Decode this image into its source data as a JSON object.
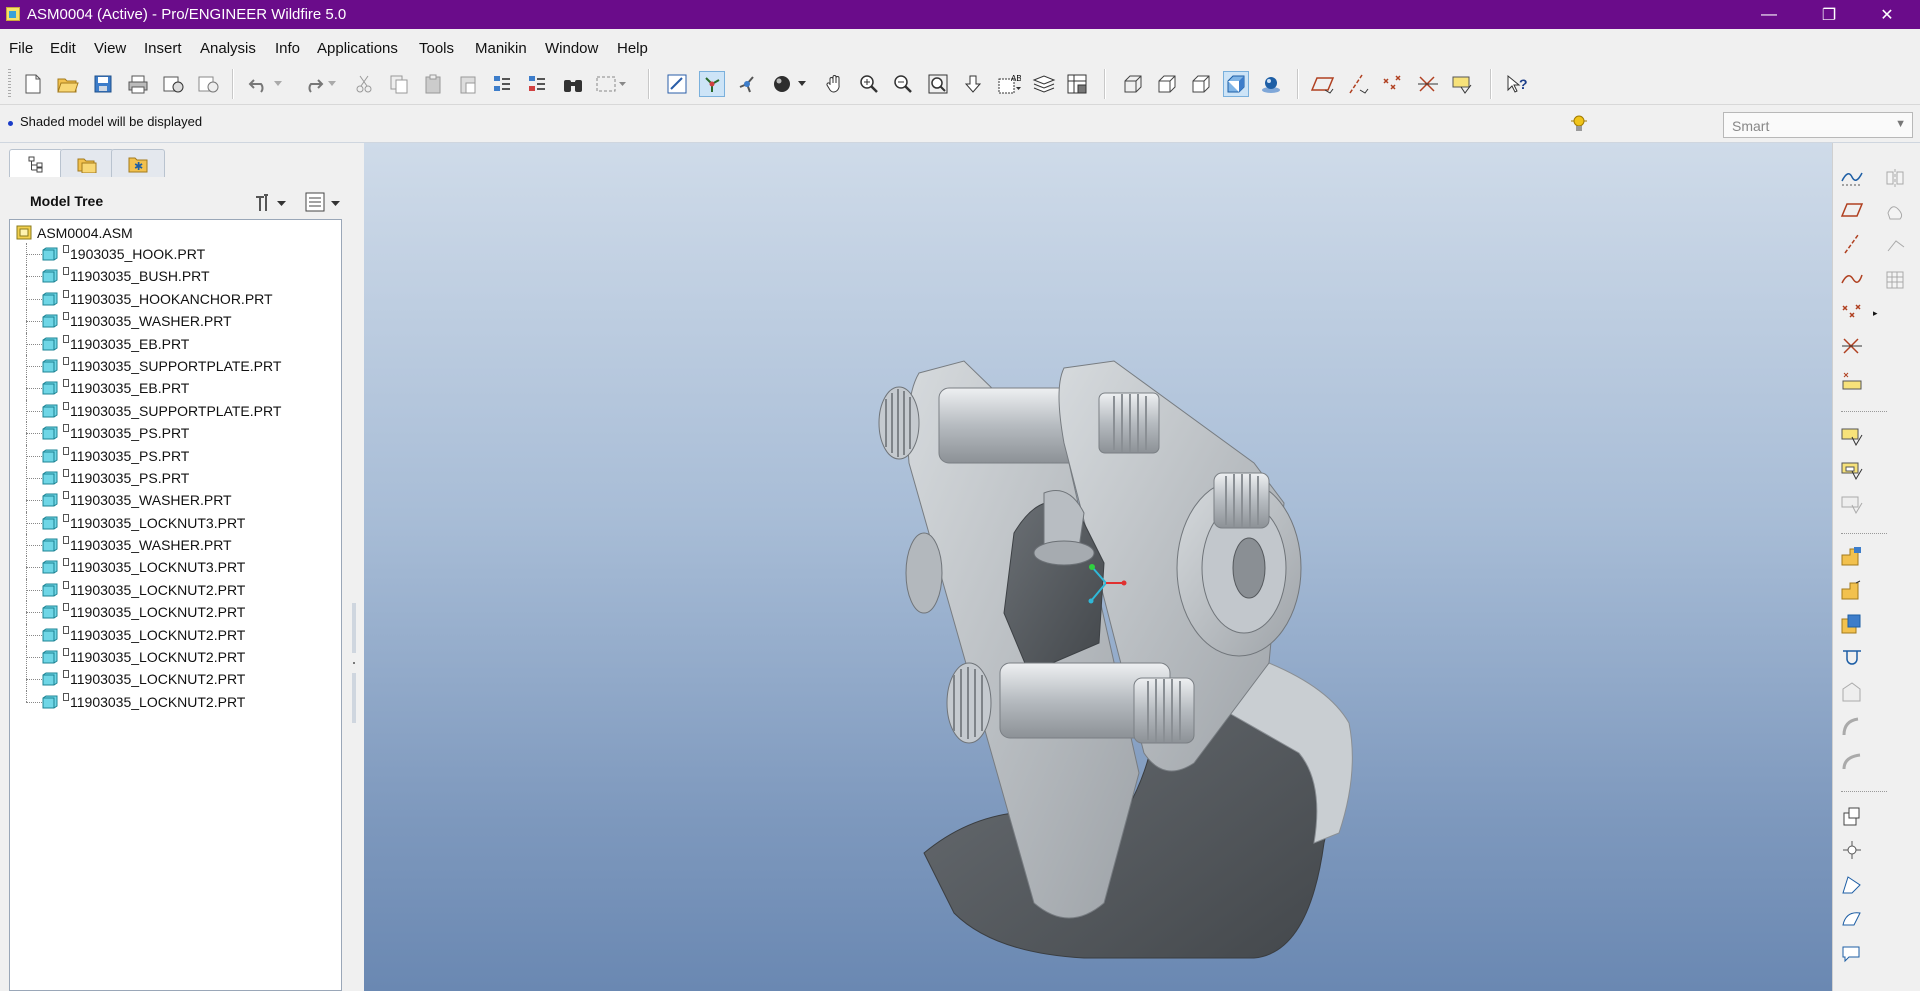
{
  "window": {
    "title": "ASM0004 (Active) - Pro/ENGINEER Wildfire 5.0",
    "controls": {
      "minimize": "—",
      "restore": "❐",
      "close": "✕"
    }
  },
  "menubar": {
    "items": [
      "File",
      "Edit",
      "View",
      "Insert",
      "Analysis",
      "Info",
      "Applications",
      "Tools",
      "Manikin",
      "Window",
      "Help"
    ]
  },
  "toolbar": {
    "icons": [
      "new-icon",
      "open-icon",
      "save-icon",
      "print-icon",
      "email-icon",
      "email-link-icon",
      "undo-icon",
      "redo-icon",
      "cut-icon",
      "copy-icon",
      "paste-icon",
      "paste-special-icon",
      "regenerate-icon",
      "regenerate-manager-icon",
      "find-icon",
      "select-box-icon",
      "repaint-icon",
      "spin-center-icon",
      "orient-mode-icon",
      "appearance-icon",
      "pan-icon",
      "zoom-in-icon",
      "zoom-out-icon",
      "refit-icon",
      "reorient-icon",
      "saved-views-icon",
      "layers-icon",
      "view-manager-icon",
      "wireframe-icon",
      "hidden-line-icon",
      "no-hidden-icon",
      "shading-icon",
      "enhanced-realism-icon",
      "datum-planes-icon",
      "datum-axes-icon",
      "datum-points-icon",
      "coordinate-systems-icon",
      "annotations-icon",
      "context-help-icon"
    ]
  },
  "status": {
    "message": "Shaded model will be displayed",
    "filter_value": "Smart"
  },
  "navigator": {
    "tabs": [
      "model-tree-tab",
      "folder-browser-tab",
      "favorites-tab"
    ],
    "title": "Model Tree",
    "root": "ASM0004.ASM",
    "items": [
      "1903035_HOOK.PRT",
      "11903035_BUSH.PRT",
      "11903035_HOOKANCHOR.PRT",
      "11903035_WASHER.PRT",
      "11903035_EB.PRT",
      "11903035_SUPPORTPLATE.PRT",
      "11903035_EB.PRT",
      "11903035_SUPPORTPLATE.PRT",
      "11903035_PS.PRT",
      "11903035_PS.PRT",
      "11903035_PS.PRT",
      "11903035_WASHER.PRT",
      "11903035_LOCKNUT3.PRT",
      "11903035_WASHER.PRT",
      "11903035_LOCKNUT3.PRT",
      "11903035_LOCKNUT2.PRT",
      "11903035_LOCKNUT2.PRT",
      "11903035_LOCKNUT2.PRT",
      "11903035_LOCKNUT2.PRT",
      "11903035_LOCKNUT2.PRT",
      "11903035_LOCKNUT2.PRT"
    ]
  },
  "right_toolbar": {
    "icons": [
      "sketch-tool-icon",
      "datum-plane-tool-icon",
      "datum-axis-tool-icon",
      "datum-curve-tool-icon",
      "datum-point-tool-icon",
      "coordinate-system-tool-icon",
      "analysis-feature-icon",
      "assemble-component-icon",
      "create-component-icon",
      "package-component-icon",
      "mirror-component-icon",
      "hole-tool-icon",
      "extrude-tool-icon",
      "revolve-tool-icon",
      "round-tool-icon",
      "chamfer-tool-icon",
      "sweep-tool-icon",
      "draft-tool-icon",
      "pattern-tool-icon",
      "shell-tool-icon",
      "rib-tool-icon",
      "surface-tool-icon"
    ]
  },
  "colors": {
    "titlebar": "#6a0c8a",
    "viewport_top": "#cfdbe9",
    "viewport_bottom": "#6a88b2",
    "model_light": "#b9bec3",
    "model_dark": "#4e5257"
  }
}
